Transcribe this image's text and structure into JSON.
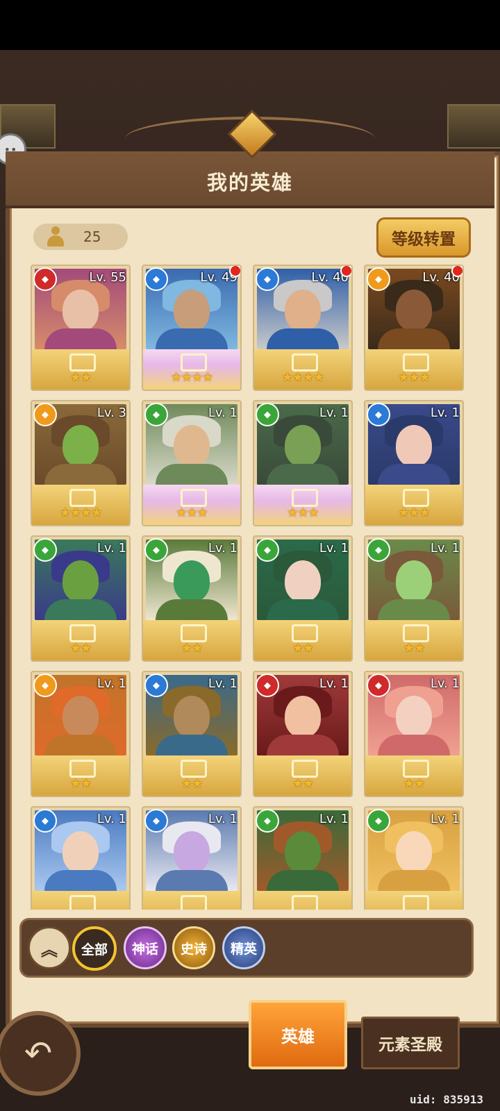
{
  "header": {
    "title": "我的英雄"
  },
  "hero_count": "25",
  "level_reset_label": "等级转置",
  "colors": {
    "fire": "#d02a2a",
    "water": "#2b7ad6",
    "light": "#f09a1c",
    "wind": "#3aa63a"
  },
  "heroes": [
    {
      "level": "Lv. 55",
      "element": "fire",
      "stars": "★★",
      "rarity": "epic",
      "red_dot": false
    },
    {
      "level": "Lv. 49",
      "element": "water",
      "stars": "★★★★",
      "rarity": "mythic",
      "red_dot": true
    },
    {
      "level": "Lv. 40",
      "element": "water",
      "stars": "★★★★",
      "rarity": "epic",
      "red_dot": true
    },
    {
      "level": "Lv. 40",
      "element": "light",
      "stars": "★★★",
      "rarity": "epic",
      "red_dot": true
    },
    {
      "level": "Lv. 3",
      "element": "light",
      "stars": "★★★★",
      "rarity": "elite",
      "red_dot": false
    },
    {
      "level": "Lv. 1",
      "element": "wind",
      "stars": "★★★",
      "rarity": "mythic",
      "red_dot": false
    },
    {
      "level": "Lv. 1",
      "element": "wind",
      "stars": "★★★",
      "rarity": "mythic",
      "red_dot": false
    },
    {
      "level": "Lv. 1",
      "element": "water",
      "stars": "★★★",
      "rarity": "epic",
      "red_dot": false
    },
    {
      "level": "Lv. 1",
      "element": "wind",
      "stars": "★★",
      "rarity": "epic",
      "red_dot": false
    },
    {
      "level": "Lv. 1",
      "element": "wind",
      "stars": "★★",
      "rarity": "epic",
      "red_dot": false
    },
    {
      "level": "Lv. 1",
      "element": "wind",
      "stars": "★★",
      "rarity": "epic",
      "red_dot": false
    },
    {
      "level": "Lv. 1",
      "element": "wind",
      "stars": "★★",
      "rarity": "epic",
      "red_dot": false
    },
    {
      "level": "Lv. 1",
      "element": "light",
      "stars": "★★",
      "rarity": "epic",
      "red_dot": false
    },
    {
      "level": "Lv. 1",
      "element": "water",
      "stars": "★★",
      "rarity": "epic",
      "red_dot": false
    },
    {
      "level": "Lv. 1",
      "element": "fire",
      "stars": "★★",
      "rarity": "epic",
      "red_dot": false
    },
    {
      "level": "Lv. 1",
      "element": "fire",
      "stars": "★★",
      "rarity": "epic",
      "red_dot": false
    },
    {
      "level": "Lv. 1",
      "element": "water",
      "stars": "",
      "rarity": "elite",
      "red_dot": false
    },
    {
      "level": "Lv. 1",
      "element": "water",
      "stars": "",
      "rarity": "elite",
      "red_dot": false
    },
    {
      "level": "Lv. 1",
      "element": "wind",
      "stars": "",
      "rarity": "elite",
      "red_dot": false
    },
    {
      "level": "Lv. 1",
      "element": "wind",
      "stars": "",
      "rarity": "elite",
      "red_dot": false
    }
  ],
  "filters": {
    "all": "全部",
    "mythic": "神话",
    "epic": "史诗",
    "elite": "精英",
    "selected": "全部"
  },
  "tabs": {
    "hero": "英雄",
    "temple": "元素圣殿",
    "active": "英雄"
  },
  "uid": "uid: 835913"
}
